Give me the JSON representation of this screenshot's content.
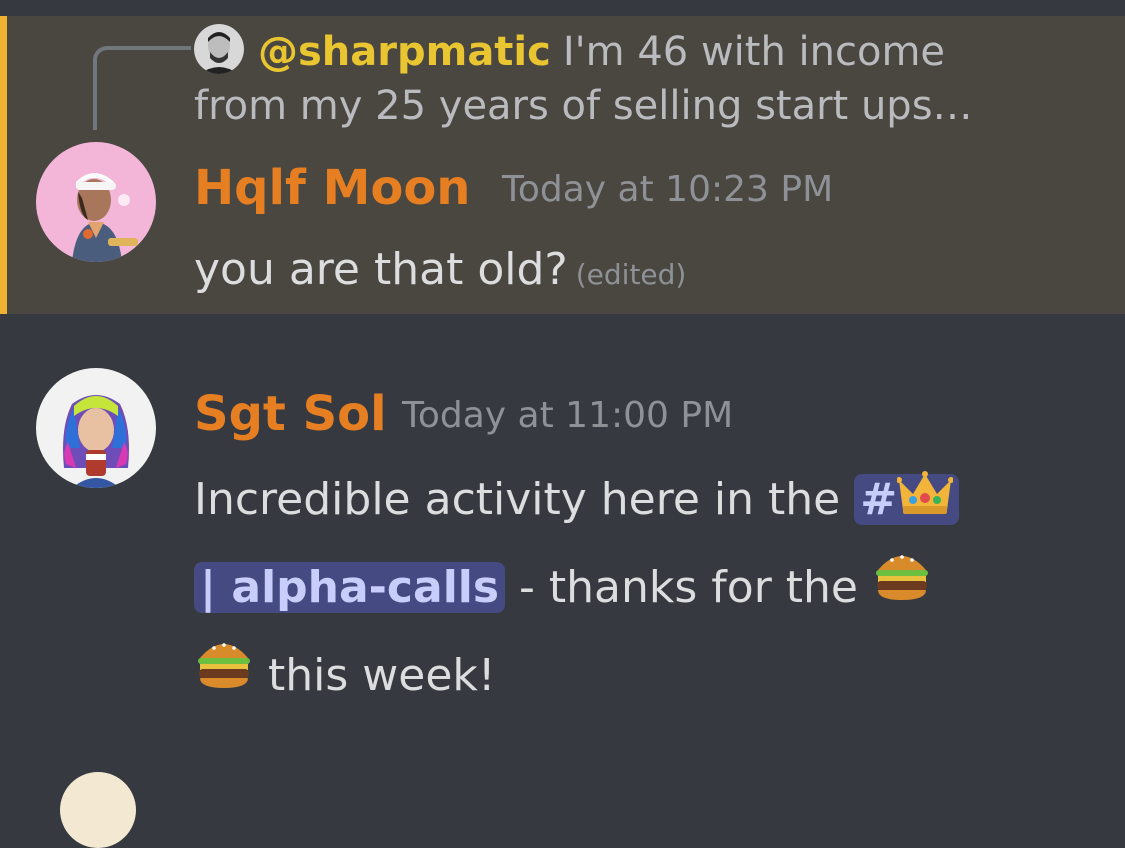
{
  "reply": {
    "author": "@sharpmatic",
    "text_line1": "I'm 46  with income",
    "text_line2": "from my 25 years of selling start ups…"
  },
  "messages": [
    {
      "author": "Hqlf Moon",
      "timestamp": "Today at 10:23 PM",
      "text": "you are that old?",
      "edited": "(edited)",
      "highlighted": true,
      "author_color": "#e67e22"
    },
    {
      "author": "Sgt Sol",
      "timestamp": "Today at 11:00 PM",
      "text_before": "Incredible activity here in the ",
      "channel_prefix": "#",
      "channel_name": "| alpha-calls",
      "text_after": " - thanks for the ",
      "text_end": " this week!",
      "author_color": "#e67e22"
    }
  ],
  "icons": {
    "reply_avatar": "avatar-sharpmatic",
    "crown": "crown-emoji",
    "burger": "hamburger-emoji"
  },
  "colors": {
    "background": "#36393f",
    "highlight": "#4a4640",
    "accent": "#f0b232",
    "mention_bg": "#454b82"
  }
}
